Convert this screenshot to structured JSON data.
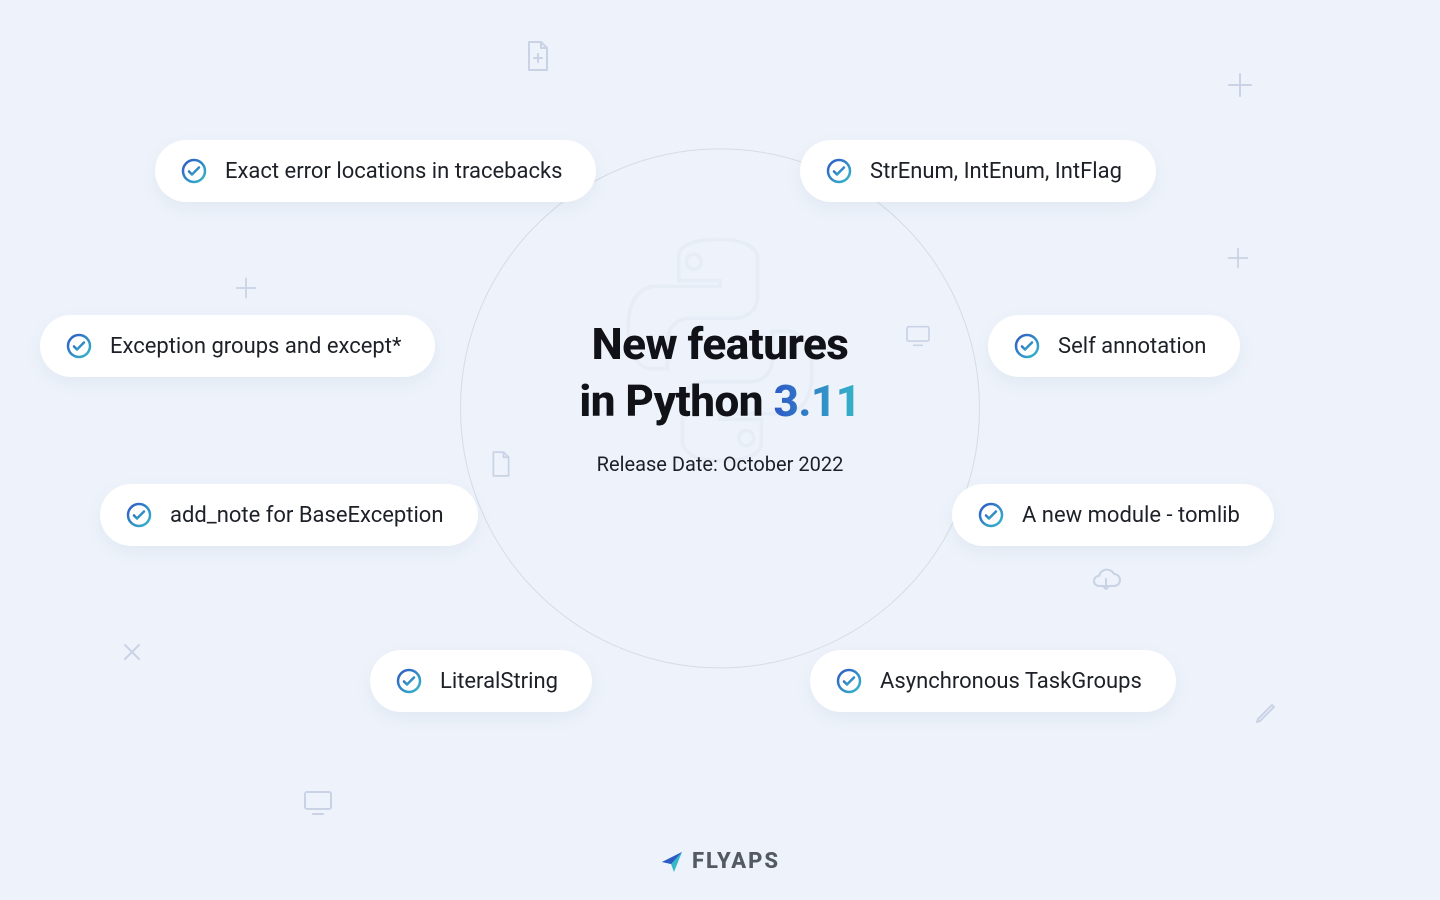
{
  "heading": {
    "line1": "New features",
    "line2_a": "in Python ",
    "line2_b": "3.11",
    "subtitle": "Release Date: October 2022"
  },
  "features": {
    "p0": "Exact error locations in tracebacks",
    "p1": "Exception groups and except*",
    "p2": "add_note for BaseException",
    "p3": "LiteralString",
    "p4": "StrEnum, IntEnum, IntFlag",
    "p5": "Self annotation",
    "p6": "A new module - tomlib",
    "p7": "Asynchronous TaskGroups"
  },
  "brand": "FLYAPS"
}
